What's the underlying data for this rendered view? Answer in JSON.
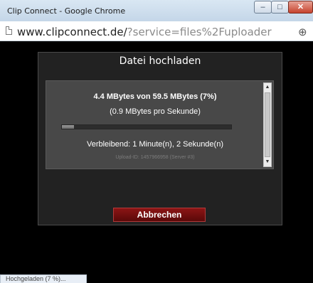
{
  "window": {
    "title": "Clip Connect - Google Chrome",
    "minimize_label": "–",
    "maximize_label": "□",
    "close_label": "✕"
  },
  "addressbar": {
    "host": "www.clipconnect.de/",
    "path": "?service=files%2Fuploader",
    "zoom_symbol": "⊕"
  },
  "dialog": {
    "title": "Datei hochladen",
    "progress_text": "4.4 MBytes von 59.5 MBytes (7%)",
    "rate_text": "(0.9 MBytes pro Sekunde)",
    "progress_fraction": 0.07,
    "remaining_text": "Verbleibend: 1 Minute(n), 2 Sekunde(n)",
    "upload_id_text": "Upload-ID: 1457966958 (Server #3)",
    "scroll_up": "▲",
    "scroll_down": "▼",
    "cancel_label": "Abbrechen"
  },
  "status": {
    "text": "Hochgeladen (7 %)..."
  }
}
